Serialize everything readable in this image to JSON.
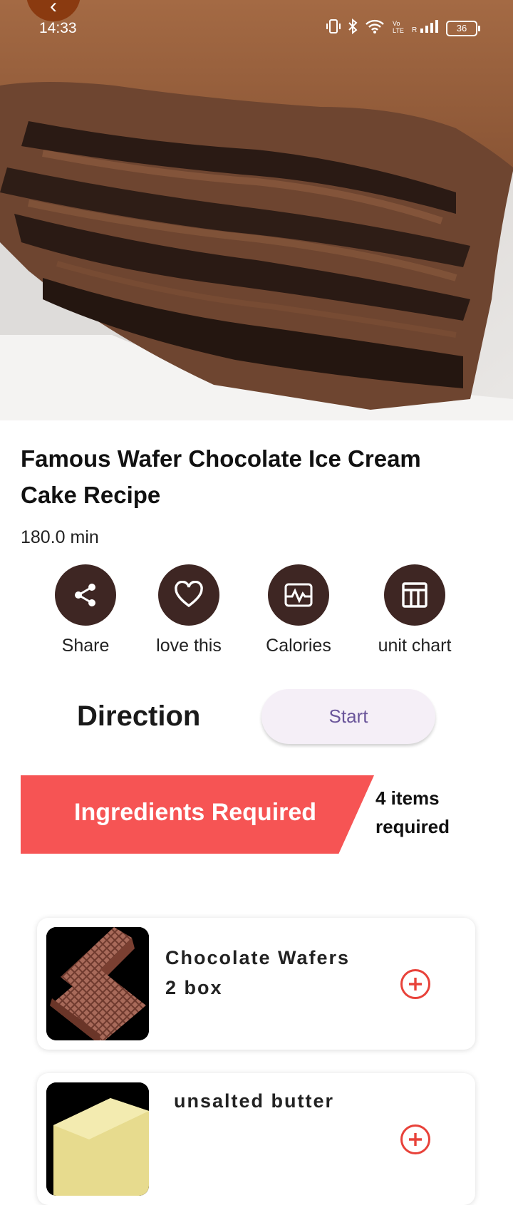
{
  "status_bar": {
    "time": "14:33",
    "battery": "36"
  },
  "recipe": {
    "title": "Famous Wafer Chocolate Ice Cream Cake Recipe",
    "duration": "180.0 min"
  },
  "actions": [
    {
      "label": "Share",
      "icon": "share-icon"
    },
    {
      "label": "love this",
      "icon": "heart-icon"
    },
    {
      "label": "Calories",
      "icon": "pulse-icon"
    },
    {
      "label": "unit chart",
      "icon": "table-icon"
    }
  ],
  "direction": {
    "heading": "Direction",
    "start_label": "Start"
  },
  "ingredients": {
    "banner": "Ingredients Required",
    "count_line1": "4 items",
    "count_line2": "required",
    "items": [
      {
        "name": "Chocolate Wafers",
        "qty": "2 box"
      },
      {
        "name": "unsalted butter",
        "qty": ""
      }
    ]
  },
  "colors": {
    "accent_dark": "#3e2623",
    "banner_red": "#f65454",
    "start_text": "#6a559a",
    "add_red": "#e8423a"
  }
}
